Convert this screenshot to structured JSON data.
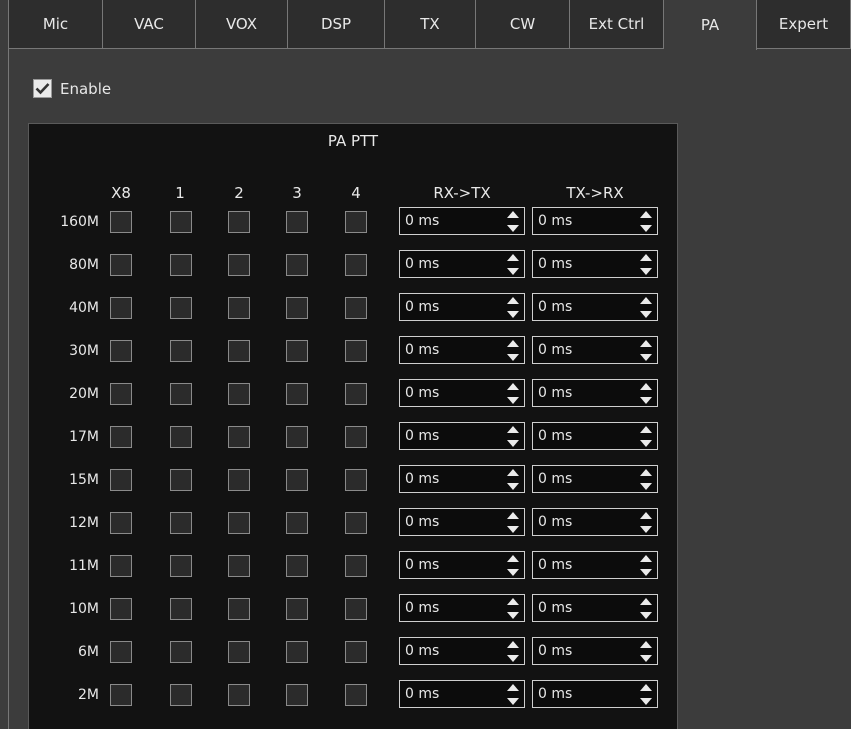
{
  "tabs": [
    {
      "label": "Mic"
    },
    {
      "label": "VAC"
    },
    {
      "label": "VOX"
    },
    {
      "label": "DSP"
    },
    {
      "label": "TX"
    },
    {
      "label": "CW"
    },
    {
      "label": "Ext Ctrl"
    },
    {
      "label": "PA",
      "active": true
    },
    {
      "label": "Expert"
    }
  ],
  "enable": {
    "label": "Enable",
    "checked": true
  },
  "group": {
    "title": "PA PTT",
    "columns": [
      "X8",
      "1",
      "2",
      "3",
      "4"
    ],
    "rx_tx_label": "RX->TX",
    "tx_rx_label": "TX->RX",
    "rows": [
      {
        "band": "160M",
        "rx_tx": "0 ms",
        "tx_rx": "0 ms"
      },
      {
        "band": "80M",
        "rx_tx": "0 ms",
        "tx_rx": "0 ms"
      },
      {
        "band": "40M",
        "rx_tx": "0 ms",
        "tx_rx": "0 ms"
      },
      {
        "band": "30M",
        "rx_tx": "0 ms",
        "tx_rx": "0 ms"
      },
      {
        "band": "20M",
        "rx_tx": "0 ms",
        "tx_rx": "0 ms"
      },
      {
        "band": "17M",
        "rx_tx": "0 ms",
        "tx_rx": "0 ms"
      },
      {
        "band": "15M",
        "rx_tx": "0 ms",
        "tx_rx": "0 ms"
      },
      {
        "band": "12M",
        "rx_tx": "0 ms",
        "tx_rx": "0 ms"
      },
      {
        "band": "11M",
        "rx_tx": "0 ms",
        "tx_rx": "0 ms"
      },
      {
        "band": "10M",
        "rx_tx": "0 ms",
        "tx_rx": "0 ms"
      },
      {
        "band": "6M",
        "rx_tx": "0 ms",
        "tx_rx": "0 ms"
      },
      {
        "band": "2M",
        "rx_tx": "0 ms",
        "tx_rx": "0 ms"
      }
    ]
  },
  "colors": {
    "background": "#3c3c3c",
    "group_bg": "#121212",
    "tab_bg": "#2d2d2d"
  }
}
